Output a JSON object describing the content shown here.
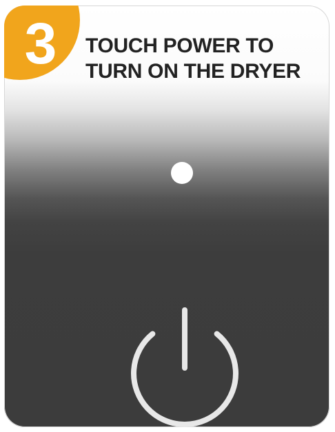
{
  "step": {
    "number": "3",
    "badge_color": "#f1a51c"
  },
  "instruction": {
    "line1": "TOUCH POWER TO",
    "line2": "TURN ON THE DRYER"
  },
  "indicator": {
    "color": "#ffffff",
    "state": "off"
  },
  "power_button": {
    "icon": "power-icon",
    "color": "#e8e8e8"
  },
  "panel": {
    "color": "#3c3c3c"
  }
}
